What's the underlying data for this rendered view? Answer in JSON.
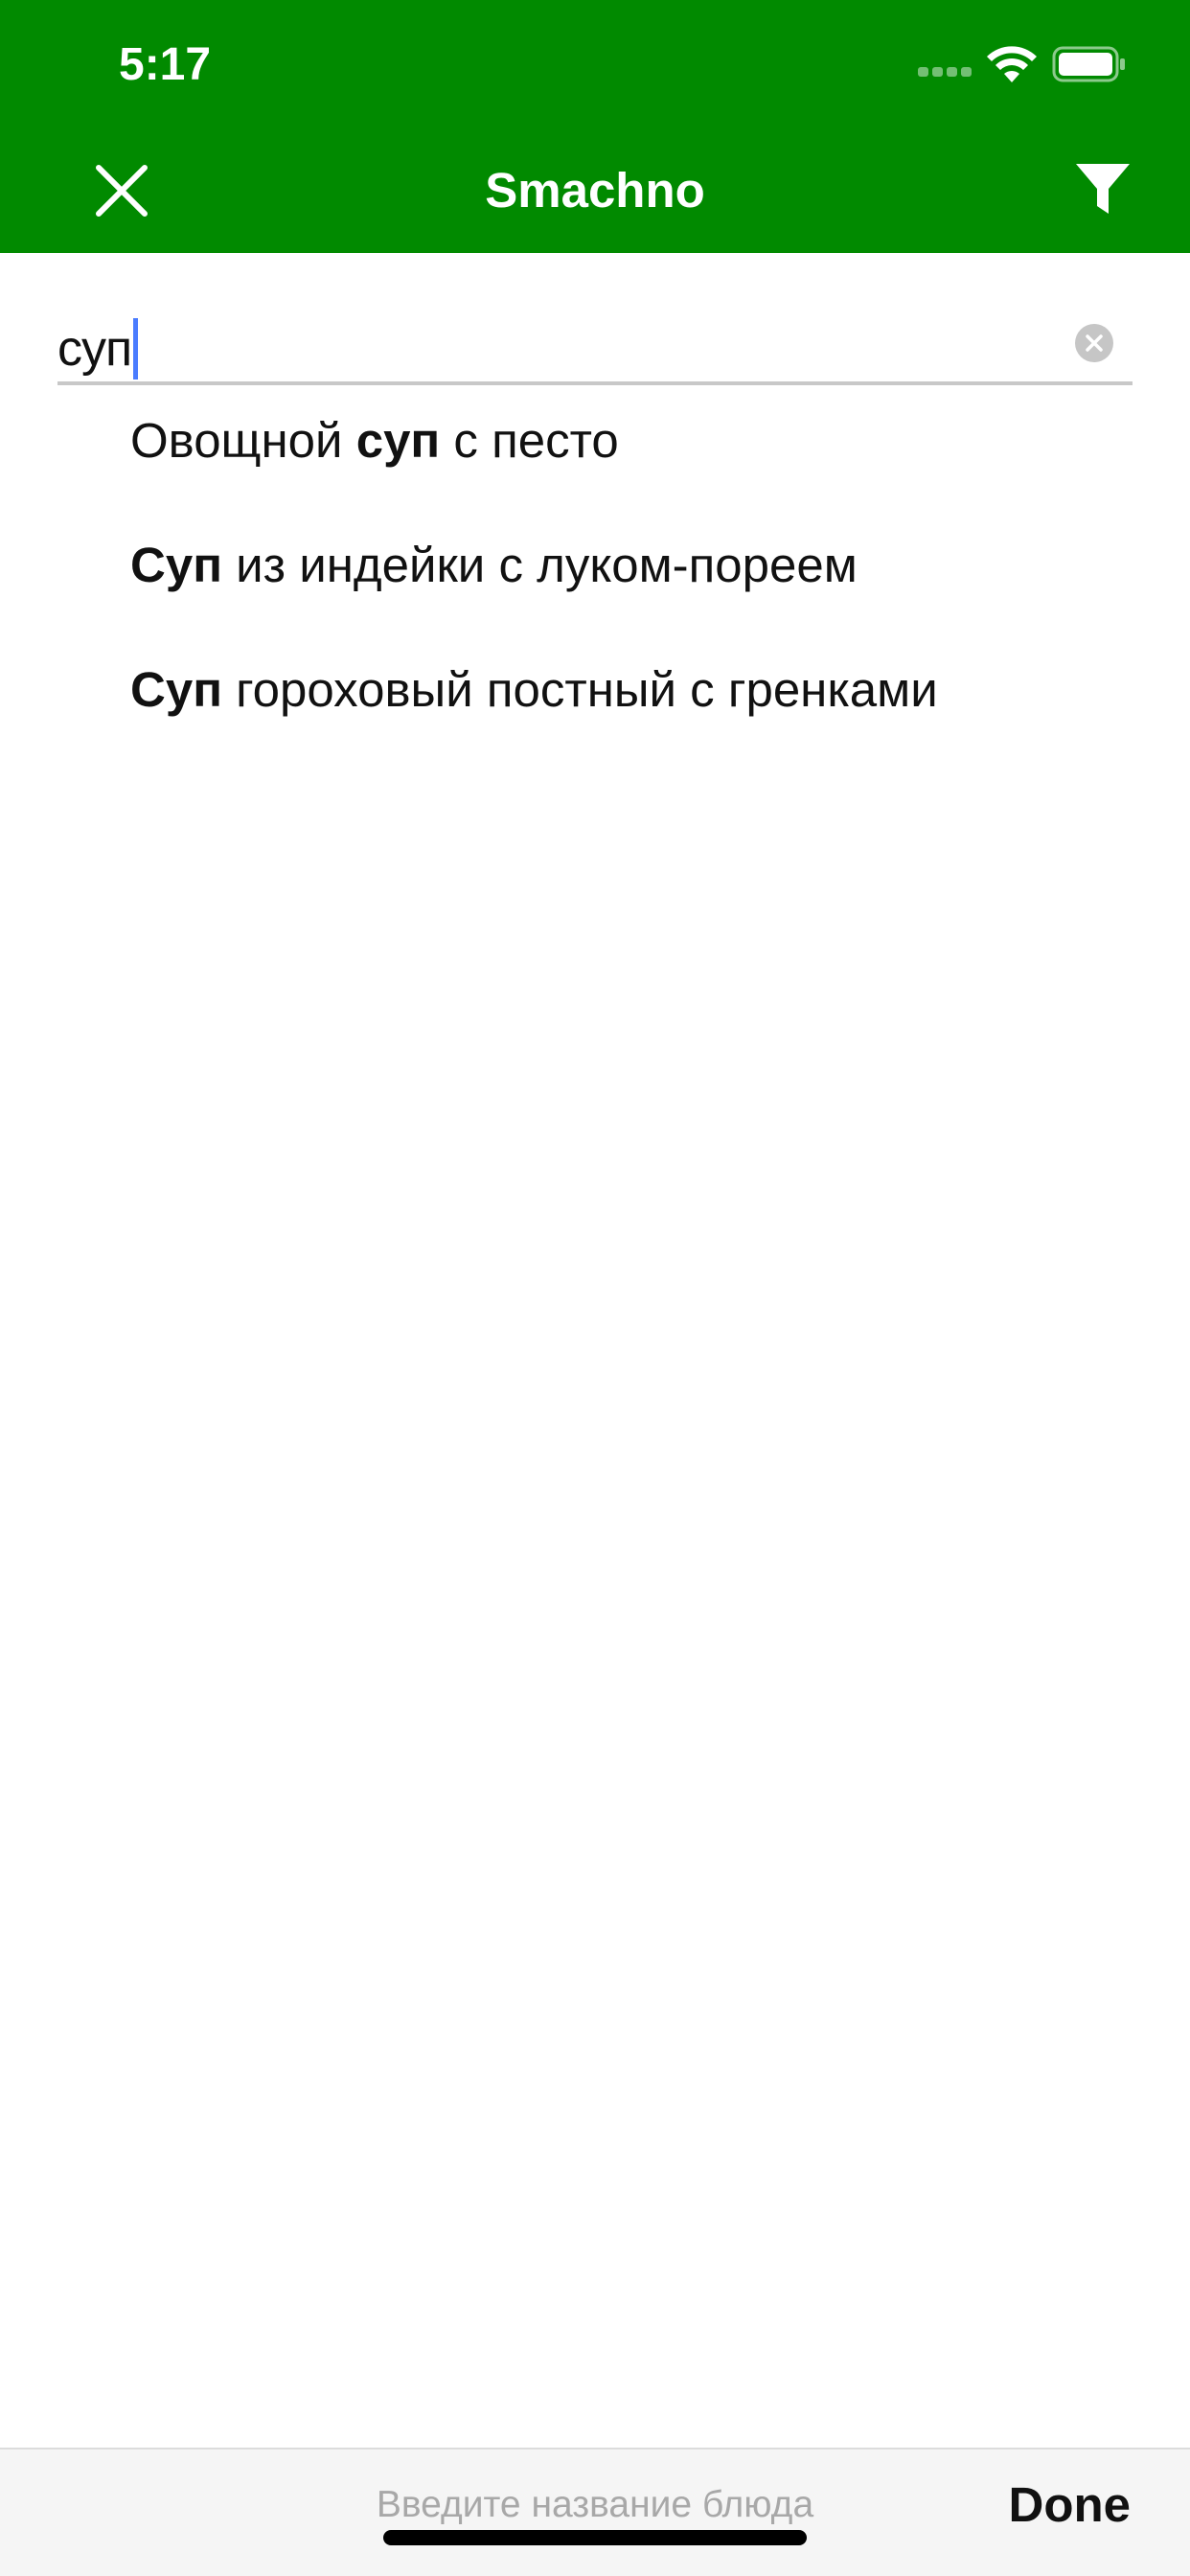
{
  "status_bar": {
    "time": "5:17",
    "wifi_icon": "wifi-icon",
    "battery_icon": "battery-icon"
  },
  "nav_bar": {
    "title": "Smachno",
    "close_icon": "close-icon",
    "filter_icon": "filter-icon",
    "background_color": "#018a00"
  },
  "search": {
    "value": "суп",
    "clear_icon": "clear-icon",
    "caret_color": "#4a7cff"
  },
  "suggestions": [
    {
      "before": "Овощной ",
      "match": "суп",
      "after": " с песто"
    },
    {
      "before": "",
      "match": "Суп",
      "after": " из индейки с луком-пореем"
    },
    {
      "before": "",
      "match": "Суп",
      "after": " гороховый постный с гренками"
    }
  ],
  "keyboard_accessory": {
    "placeholder": "Введите название блюда",
    "done_label": "Done"
  }
}
